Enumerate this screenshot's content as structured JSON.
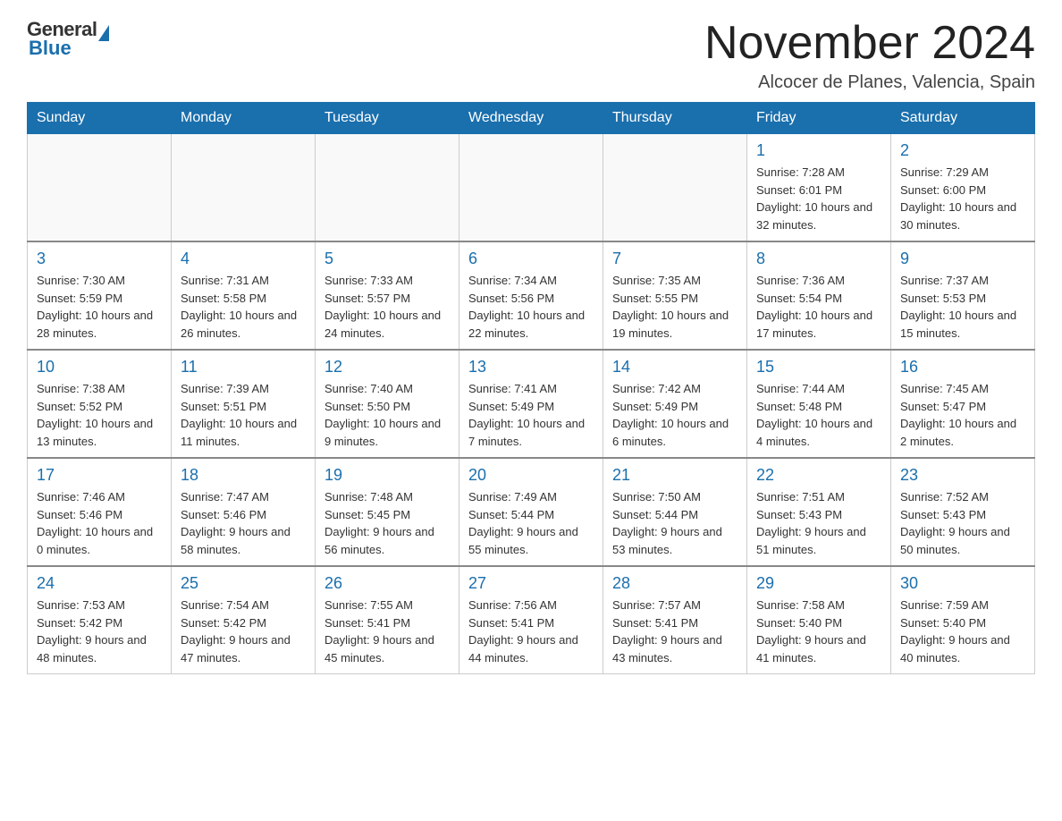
{
  "header": {
    "logo_general": "General",
    "logo_blue": "Blue",
    "month_title": "November 2024",
    "location": "Alcocer de Planes, Valencia, Spain"
  },
  "weekdays": [
    "Sunday",
    "Monday",
    "Tuesday",
    "Wednesday",
    "Thursday",
    "Friday",
    "Saturday"
  ],
  "weeks": [
    [
      {
        "day": "",
        "info": ""
      },
      {
        "day": "",
        "info": ""
      },
      {
        "day": "",
        "info": ""
      },
      {
        "day": "",
        "info": ""
      },
      {
        "day": "",
        "info": ""
      },
      {
        "day": "1",
        "info": "Sunrise: 7:28 AM\nSunset: 6:01 PM\nDaylight: 10 hours and 32 minutes."
      },
      {
        "day": "2",
        "info": "Sunrise: 7:29 AM\nSunset: 6:00 PM\nDaylight: 10 hours and 30 minutes."
      }
    ],
    [
      {
        "day": "3",
        "info": "Sunrise: 7:30 AM\nSunset: 5:59 PM\nDaylight: 10 hours and 28 minutes."
      },
      {
        "day": "4",
        "info": "Sunrise: 7:31 AM\nSunset: 5:58 PM\nDaylight: 10 hours and 26 minutes."
      },
      {
        "day": "5",
        "info": "Sunrise: 7:33 AM\nSunset: 5:57 PM\nDaylight: 10 hours and 24 minutes."
      },
      {
        "day": "6",
        "info": "Sunrise: 7:34 AM\nSunset: 5:56 PM\nDaylight: 10 hours and 22 minutes."
      },
      {
        "day": "7",
        "info": "Sunrise: 7:35 AM\nSunset: 5:55 PM\nDaylight: 10 hours and 19 minutes."
      },
      {
        "day": "8",
        "info": "Sunrise: 7:36 AM\nSunset: 5:54 PM\nDaylight: 10 hours and 17 minutes."
      },
      {
        "day": "9",
        "info": "Sunrise: 7:37 AM\nSunset: 5:53 PM\nDaylight: 10 hours and 15 minutes."
      }
    ],
    [
      {
        "day": "10",
        "info": "Sunrise: 7:38 AM\nSunset: 5:52 PM\nDaylight: 10 hours and 13 minutes."
      },
      {
        "day": "11",
        "info": "Sunrise: 7:39 AM\nSunset: 5:51 PM\nDaylight: 10 hours and 11 minutes."
      },
      {
        "day": "12",
        "info": "Sunrise: 7:40 AM\nSunset: 5:50 PM\nDaylight: 10 hours and 9 minutes."
      },
      {
        "day": "13",
        "info": "Sunrise: 7:41 AM\nSunset: 5:49 PM\nDaylight: 10 hours and 7 minutes."
      },
      {
        "day": "14",
        "info": "Sunrise: 7:42 AM\nSunset: 5:49 PM\nDaylight: 10 hours and 6 minutes."
      },
      {
        "day": "15",
        "info": "Sunrise: 7:44 AM\nSunset: 5:48 PM\nDaylight: 10 hours and 4 minutes."
      },
      {
        "day": "16",
        "info": "Sunrise: 7:45 AM\nSunset: 5:47 PM\nDaylight: 10 hours and 2 minutes."
      }
    ],
    [
      {
        "day": "17",
        "info": "Sunrise: 7:46 AM\nSunset: 5:46 PM\nDaylight: 10 hours and 0 minutes."
      },
      {
        "day": "18",
        "info": "Sunrise: 7:47 AM\nSunset: 5:46 PM\nDaylight: 9 hours and 58 minutes."
      },
      {
        "day": "19",
        "info": "Sunrise: 7:48 AM\nSunset: 5:45 PM\nDaylight: 9 hours and 56 minutes."
      },
      {
        "day": "20",
        "info": "Sunrise: 7:49 AM\nSunset: 5:44 PM\nDaylight: 9 hours and 55 minutes."
      },
      {
        "day": "21",
        "info": "Sunrise: 7:50 AM\nSunset: 5:44 PM\nDaylight: 9 hours and 53 minutes."
      },
      {
        "day": "22",
        "info": "Sunrise: 7:51 AM\nSunset: 5:43 PM\nDaylight: 9 hours and 51 minutes."
      },
      {
        "day": "23",
        "info": "Sunrise: 7:52 AM\nSunset: 5:43 PM\nDaylight: 9 hours and 50 minutes."
      }
    ],
    [
      {
        "day": "24",
        "info": "Sunrise: 7:53 AM\nSunset: 5:42 PM\nDaylight: 9 hours and 48 minutes."
      },
      {
        "day": "25",
        "info": "Sunrise: 7:54 AM\nSunset: 5:42 PM\nDaylight: 9 hours and 47 minutes."
      },
      {
        "day": "26",
        "info": "Sunrise: 7:55 AM\nSunset: 5:41 PM\nDaylight: 9 hours and 45 minutes."
      },
      {
        "day": "27",
        "info": "Sunrise: 7:56 AM\nSunset: 5:41 PM\nDaylight: 9 hours and 44 minutes."
      },
      {
        "day": "28",
        "info": "Sunrise: 7:57 AM\nSunset: 5:41 PM\nDaylight: 9 hours and 43 minutes."
      },
      {
        "day": "29",
        "info": "Sunrise: 7:58 AM\nSunset: 5:40 PM\nDaylight: 9 hours and 41 minutes."
      },
      {
        "day": "30",
        "info": "Sunrise: 7:59 AM\nSunset: 5:40 PM\nDaylight: 9 hours and 40 minutes."
      }
    ]
  ]
}
